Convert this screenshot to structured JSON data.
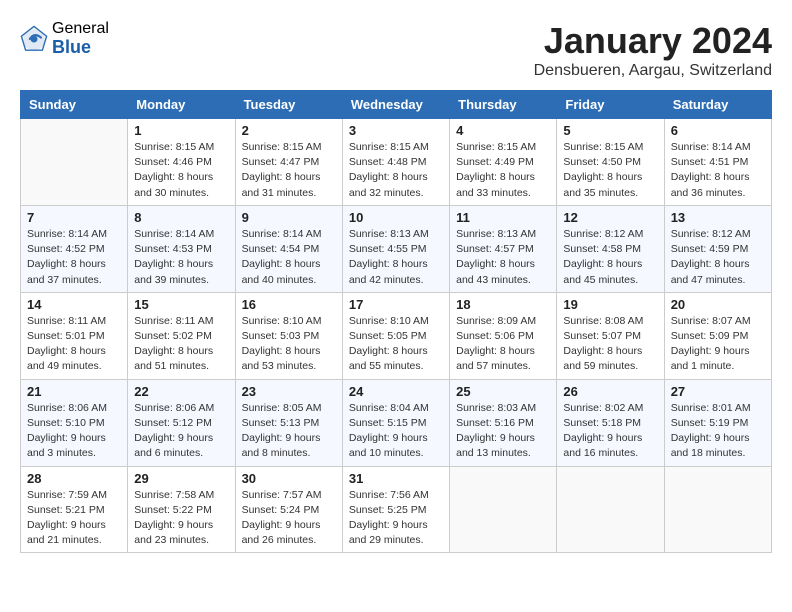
{
  "app": {
    "logo_general": "General",
    "logo_blue": "Blue"
  },
  "calendar": {
    "title": "January 2024",
    "subtitle": "Densbueren, Aargau, Switzerland"
  },
  "weekdays": [
    "Sunday",
    "Monday",
    "Tuesday",
    "Wednesday",
    "Thursday",
    "Friday",
    "Saturday"
  ],
  "weeks": [
    [
      {
        "day": "",
        "sunrise": "",
        "sunset": "",
        "daylight": ""
      },
      {
        "day": "1",
        "sunrise": "Sunrise: 8:15 AM",
        "sunset": "Sunset: 4:46 PM",
        "daylight": "Daylight: 8 hours and 30 minutes."
      },
      {
        "day": "2",
        "sunrise": "Sunrise: 8:15 AM",
        "sunset": "Sunset: 4:47 PM",
        "daylight": "Daylight: 8 hours and 31 minutes."
      },
      {
        "day": "3",
        "sunrise": "Sunrise: 8:15 AM",
        "sunset": "Sunset: 4:48 PM",
        "daylight": "Daylight: 8 hours and 32 minutes."
      },
      {
        "day": "4",
        "sunrise": "Sunrise: 8:15 AM",
        "sunset": "Sunset: 4:49 PM",
        "daylight": "Daylight: 8 hours and 33 minutes."
      },
      {
        "day": "5",
        "sunrise": "Sunrise: 8:15 AM",
        "sunset": "Sunset: 4:50 PM",
        "daylight": "Daylight: 8 hours and 35 minutes."
      },
      {
        "day": "6",
        "sunrise": "Sunrise: 8:14 AM",
        "sunset": "Sunset: 4:51 PM",
        "daylight": "Daylight: 8 hours and 36 minutes."
      }
    ],
    [
      {
        "day": "7",
        "sunrise": "Sunrise: 8:14 AM",
        "sunset": "Sunset: 4:52 PM",
        "daylight": "Daylight: 8 hours and 37 minutes."
      },
      {
        "day": "8",
        "sunrise": "Sunrise: 8:14 AM",
        "sunset": "Sunset: 4:53 PM",
        "daylight": "Daylight: 8 hours and 39 minutes."
      },
      {
        "day": "9",
        "sunrise": "Sunrise: 8:14 AM",
        "sunset": "Sunset: 4:54 PM",
        "daylight": "Daylight: 8 hours and 40 minutes."
      },
      {
        "day": "10",
        "sunrise": "Sunrise: 8:13 AM",
        "sunset": "Sunset: 4:55 PM",
        "daylight": "Daylight: 8 hours and 42 minutes."
      },
      {
        "day": "11",
        "sunrise": "Sunrise: 8:13 AM",
        "sunset": "Sunset: 4:57 PM",
        "daylight": "Daylight: 8 hours and 43 minutes."
      },
      {
        "day": "12",
        "sunrise": "Sunrise: 8:12 AM",
        "sunset": "Sunset: 4:58 PM",
        "daylight": "Daylight: 8 hours and 45 minutes."
      },
      {
        "day": "13",
        "sunrise": "Sunrise: 8:12 AM",
        "sunset": "Sunset: 4:59 PM",
        "daylight": "Daylight: 8 hours and 47 minutes."
      }
    ],
    [
      {
        "day": "14",
        "sunrise": "Sunrise: 8:11 AM",
        "sunset": "Sunset: 5:01 PM",
        "daylight": "Daylight: 8 hours and 49 minutes."
      },
      {
        "day": "15",
        "sunrise": "Sunrise: 8:11 AM",
        "sunset": "Sunset: 5:02 PM",
        "daylight": "Daylight: 8 hours and 51 minutes."
      },
      {
        "day": "16",
        "sunrise": "Sunrise: 8:10 AM",
        "sunset": "Sunset: 5:03 PM",
        "daylight": "Daylight: 8 hours and 53 minutes."
      },
      {
        "day": "17",
        "sunrise": "Sunrise: 8:10 AM",
        "sunset": "Sunset: 5:05 PM",
        "daylight": "Daylight: 8 hours and 55 minutes."
      },
      {
        "day": "18",
        "sunrise": "Sunrise: 8:09 AM",
        "sunset": "Sunset: 5:06 PM",
        "daylight": "Daylight: 8 hours and 57 minutes."
      },
      {
        "day": "19",
        "sunrise": "Sunrise: 8:08 AM",
        "sunset": "Sunset: 5:07 PM",
        "daylight": "Daylight: 8 hours and 59 minutes."
      },
      {
        "day": "20",
        "sunrise": "Sunrise: 8:07 AM",
        "sunset": "Sunset: 5:09 PM",
        "daylight": "Daylight: 9 hours and 1 minute."
      }
    ],
    [
      {
        "day": "21",
        "sunrise": "Sunrise: 8:06 AM",
        "sunset": "Sunset: 5:10 PM",
        "daylight": "Daylight: 9 hours and 3 minutes."
      },
      {
        "day": "22",
        "sunrise": "Sunrise: 8:06 AM",
        "sunset": "Sunset: 5:12 PM",
        "daylight": "Daylight: 9 hours and 6 minutes."
      },
      {
        "day": "23",
        "sunrise": "Sunrise: 8:05 AM",
        "sunset": "Sunset: 5:13 PM",
        "daylight": "Daylight: 9 hours and 8 minutes."
      },
      {
        "day": "24",
        "sunrise": "Sunrise: 8:04 AM",
        "sunset": "Sunset: 5:15 PM",
        "daylight": "Daylight: 9 hours and 10 minutes."
      },
      {
        "day": "25",
        "sunrise": "Sunrise: 8:03 AM",
        "sunset": "Sunset: 5:16 PM",
        "daylight": "Daylight: 9 hours and 13 minutes."
      },
      {
        "day": "26",
        "sunrise": "Sunrise: 8:02 AM",
        "sunset": "Sunset: 5:18 PM",
        "daylight": "Daylight: 9 hours and 16 minutes."
      },
      {
        "day": "27",
        "sunrise": "Sunrise: 8:01 AM",
        "sunset": "Sunset: 5:19 PM",
        "daylight": "Daylight: 9 hours and 18 minutes."
      }
    ],
    [
      {
        "day": "28",
        "sunrise": "Sunrise: 7:59 AM",
        "sunset": "Sunset: 5:21 PM",
        "daylight": "Daylight: 9 hours and 21 minutes."
      },
      {
        "day": "29",
        "sunrise": "Sunrise: 7:58 AM",
        "sunset": "Sunset: 5:22 PM",
        "daylight": "Daylight: 9 hours and 23 minutes."
      },
      {
        "day": "30",
        "sunrise": "Sunrise: 7:57 AM",
        "sunset": "Sunset: 5:24 PM",
        "daylight": "Daylight: 9 hours and 26 minutes."
      },
      {
        "day": "31",
        "sunrise": "Sunrise: 7:56 AM",
        "sunset": "Sunset: 5:25 PM",
        "daylight": "Daylight: 9 hours and 29 minutes."
      },
      {
        "day": "",
        "sunrise": "",
        "sunset": "",
        "daylight": ""
      },
      {
        "day": "",
        "sunrise": "",
        "sunset": "",
        "daylight": ""
      },
      {
        "day": "",
        "sunrise": "",
        "sunset": "",
        "daylight": ""
      }
    ]
  ]
}
